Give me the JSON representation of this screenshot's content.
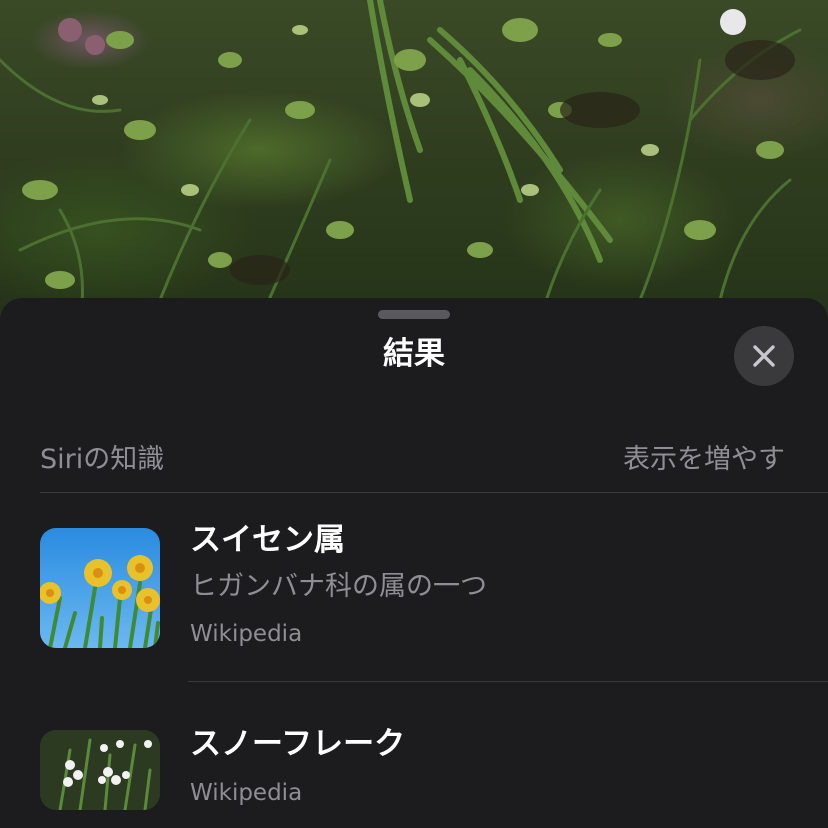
{
  "sheet": {
    "title": "結果",
    "close_icon": "close-icon"
  },
  "section": {
    "title": "Siriの知識",
    "show_more_label": "表示を増やす"
  },
  "results": [
    {
      "title": "スイセン属",
      "subtitle": "ヒガンバナ科の属の一つ",
      "source": "Wikipedia",
      "thumbnail": "daffodil-photo"
    },
    {
      "title": "スノーフレーク",
      "source": "Wikipedia",
      "thumbnail": "snowflake-flower-photo"
    }
  ],
  "colors": {
    "sheet_background": "#1c1c1e",
    "primary_text": "#ffffff",
    "secondary_text": "#8e8e93",
    "separator": "#3a3a3c"
  }
}
